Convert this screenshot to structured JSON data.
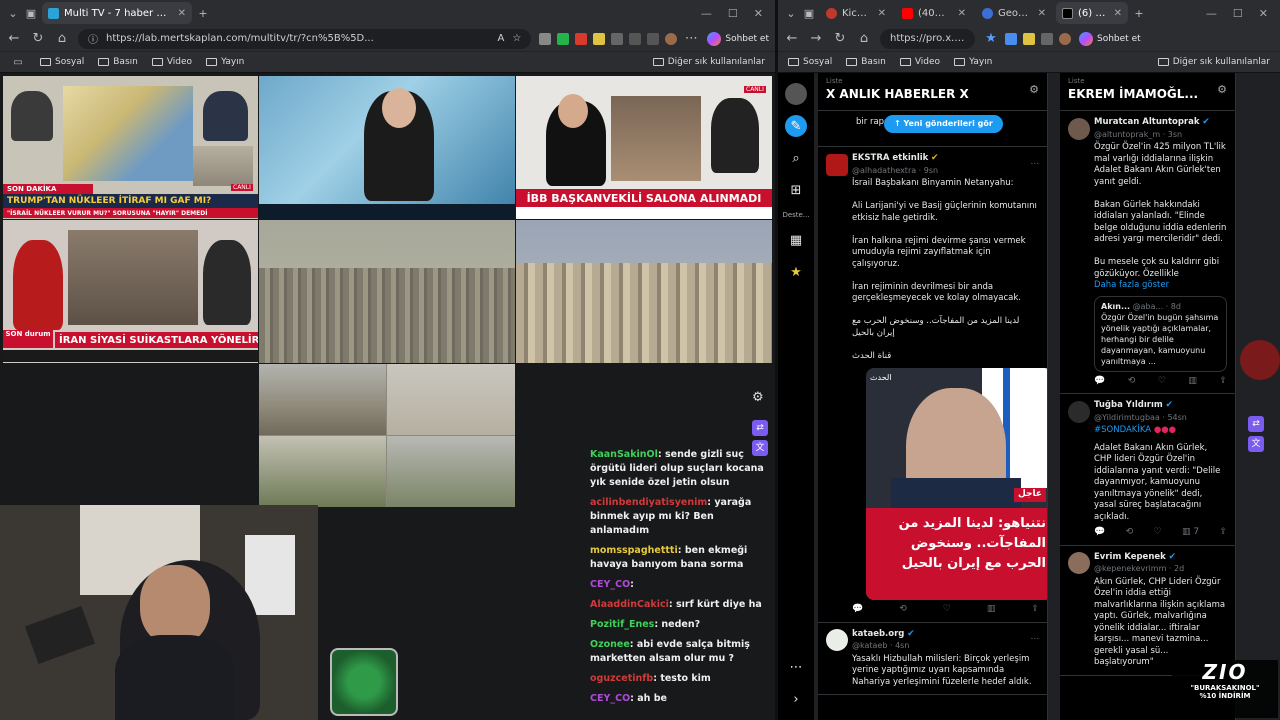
{
  "left_browser": {
    "tabs": [
      {
        "title": "Multi TV - 7 haber kanalını aynı an"
      }
    ],
    "url": "https://lab.mertskaplan.com/multitv/tr/?cn%5B%5D...",
    "copilot_label": "Sohbet et",
    "bookmarks": [
      "Sosyal",
      "Basın",
      "Video",
      "Yayın"
    ],
    "other_bookmarks": "Diğer sık kullanılanlar"
  },
  "tv": {
    "tile1": {
      "ticker_top": "SON DAKİKA",
      "headline": "TRUMP'TAN NÜKLEER İTİRAF MI GAF MI?",
      "sub": "\"İSRAİL NÜKLEER VURUR MU?\" SORUSUNA \"HAYIR\" DEMEDİ",
      "live": "CANLI"
    },
    "tile3": {
      "headline": "İBB BAŞKANVEKİLİ SALONA ALINMADI",
      "live": "CANLI"
    },
    "tile4": {
      "headline": "İRAN SİYASİ SUİKASTLARA YÖNELİR Mİ?",
      "badge": "SON durum"
    }
  },
  "chat": [
    {
      "user": "KaanSakinOl",
      "msg": "sende gizli suç örgütü lideri olup suçları kocana yık senide özel jetin olsun",
      "color": "#3fd15a"
    },
    {
      "user": "acilinbendiyatisyenim",
      "msg": "yarağa binmek ayıp mı ki? Ben anlamadım",
      "color": "#d23a3a"
    },
    {
      "user": "momsspaghettti",
      "msg": "ben ekmeği havaya banıyom bana sorma",
      "color": "#e6c93d"
    },
    {
      "user": "CEY_CO",
      "msg": "",
      "color": "#b04ad6"
    },
    {
      "user": "AlaaddinCakici",
      "msg": "sırf kürt diye ha",
      "color": "#d23a3a"
    },
    {
      "user": "Pozitif_Enes",
      "msg": "neden?",
      "color": "#3fd15a"
    },
    {
      "user": "Ozonee",
      "msg": "abi evde salça bitmiş marketten alsam olur mu ?",
      "color": "#3fd15a"
    },
    {
      "user": "oguzcetinfb",
      "msg": "testo kim",
      "color": "#d23a3a"
    },
    {
      "user": "CEY_CO",
      "msg": "ah be",
      "color": "#b04ad6"
    }
  ],
  "right_browser": {
    "tabs": [
      {
        "title": "KickPeek"
      },
      {
        "title": "(404) Kocan"
      },
      {
        "title": "GeoPulse"
      },
      {
        "title": "(6) X Pro"
      }
    ],
    "url": "https://pro.x.c...",
    "copilot_label": "Sohbet et",
    "bookmarks": [
      "Sosyal",
      "Basın",
      "Video",
      "Yayın"
    ],
    "other_bookmarks": "Diğer sık kullanılanlar"
  },
  "x_sidebar": {
    "deste_label": "Deste..."
  },
  "col1": {
    "small": "Liste",
    "title": "X ANLIK HABERLER X",
    "prev_text": "bir rapor talep etti.",
    "new_posts": "Yeni gönderileri gör",
    "tweet1": {
      "name": "EKSTRA etkinlik",
      "handle": "@alhadathextra · 9sn",
      "body": "İsrail Başbakanı Binyamin Netanyahu:\n\nAli Larijani'yi ve Basij güçlerinin komutanını etkisiz hale getirdik.\n\nİran halkına rejimi devirme şansı vermek umuduyla rejimi zayıflatmak için çalışıyoruz.\n\nİran rejiminin devrilmesi bir anda gerçekleşmeyecek ve kolay olmayacak.\n\nلدينا المزيد من المفاجآت.. وسنخوض الحرب مع إيران بالحيل\n\nقناة الحدث",
      "img_text": "نتنياهو: لدينا المزيد من المفاجآت.. وسنخوض الحرب مع إيران بالحيل",
      "img_tag": "عاجل",
      "img_logo": "الحدث"
    },
    "tweet2": {
      "name": "kataeb.org",
      "handle": "@kataeb · 4sn",
      "body": "Yasaklı Hizbullah milisleri: Birçok yerleşim yerine yaptığımız uyarı kapsamında Nahariya yerleşimini füzelerle hedef aldık."
    }
  },
  "col2": {
    "small": "Liste",
    "title": "EKREM İMAMOĞL...",
    "tweet1": {
      "name": "Muratcan Altuntoprak",
      "handle": "@altuntoprak_m · 3sn",
      "body": "Özgür Özel'in 425 milyon TL'lik mal varlığı iddialarına ilişkin Adalet Bakanı Akın Gürlek'ten yanıt geldi.\n\nBakan Gürlek hakkındaki iddiaları yalanladı. \"Elinde belge olduğunu iddia edenlerin adresi yargı mercileridir\" dedi.\n\nBu mesele çok su kaldırır gibi gözüküyor. Özellikle",
      "more": "Daha fazla göster",
      "quote_name": "Akın...",
      "quote_handle": "@aba... · 8d",
      "quote_body": "Özgür Özel'in bugün şahsıma yönelik yaptığı açıklamalar, herhangi bir delile dayanmayan, kamuoyunu yanıltmaya ..."
    },
    "tweet2": {
      "name": "Tuğba Yıldırım",
      "handle": "@Yildirimtugbaa · 54sn",
      "tag": "#SONDAKİKA",
      "body": "Adalet Bakanı Akın Gürlek, CHP lideri Özgür Özel'in iddialarına yanıt verdi: \"Delile dayanmıyor, kamuoyunu yanıltmaya yönelik\" dedi, yasal süreç başlatacağını açıkladı.",
      "count": "7"
    },
    "tweet3": {
      "name": "Evrim Kepenek",
      "handle": "@kepenekevrimm · 2d",
      "body": "Akın Gürlek, CHP Lideri Özgür Özel'in iddia ettiği malvarlıklarına ilişkin açıklama yaptı. Gürlek, malvarlığına yönelik iddialar... iftiralar karşısı... manevi tazmina... gerekli yasal sü... başlatıyorum\""
    }
  },
  "promo": {
    "brand": "ZIO",
    "code": "\"BURAKSAKINOL\"",
    "discount": "%10 İNDİRİM"
  },
  "colors": {
    "x_blue": "#1d9bf0",
    "news_red": "#c8102e",
    "chrome_dark": "#2b2d31"
  }
}
